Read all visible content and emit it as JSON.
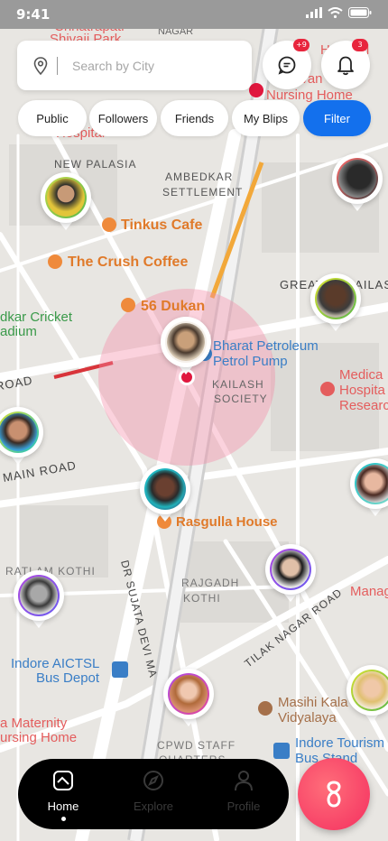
{
  "status_bar": {
    "time": "9:41"
  },
  "search": {
    "placeholder": "Search by City"
  },
  "header": {
    "messages_badge": "+9",
    "notifications_badge": "3"
  },
  "filters": {
    "chips": [
      "Public",
      "Followers",
      "Friends",
      "My Blips"
    ],
    "filter_label": "Filter"
  },
  "map_labels": {
    "chhatrapati": "Chhatrapati",
    "shivaji_park": "Shivaji Park",
    "nagar": "NAGAR",
    "hospital_top": "Hospital",
    "navjivan": "Navjivan",
    "nursing_home": "Nursing Home",
    "hospital_left": "Hospital",
    "new_palasia": "NEW PALASIA",
    "ambedkar": "AMBEDKAR",
    "settlement": "SETTLEMENT",
    "tinkus": "Tinkus Cafe",
    "crush": "The Crush Coffee",
    "greater": "GREATER KAILASH",
    "cricket": "dkar Cricket",
    "stadium": "adium",
    "dukan": "56 Dukan",
    "bharat": "Bharat Petroleum",
    "petrol": "Petrol Pump",
    "kailash": "KAILASH",
    "society": "SOCIETY",
    "medica": "Medica",
    "hospital_r": "Hospita",
    "research": "Researc",
    "road": "ROAD",
    "main_road": "MAIN ROAD",
    "rasgulla": "Rasgulla House",
    "kothi": "RATLAM KOTHI",
    "rajgadh": "RAJGADH",
    "kothi2": "KOTHI",
    "sujata": "DR SUJATA DEVI MA",
    "tilak": "TILAK NAGAR ROAD",
    "manag": "Manag",
    "aictsl": "Indore AICTSL",
    "bus_depot": "Bus Depot",
    "masihi": "Masihi Kala",
    "vidyalaya": "Vidyalaya",
    "maternity": "a Maternity",
    "nursing2": "ursing Home",
    "cpwd": "CPWD STAFF",
    "quarters": "QUARTERS",
    "tourism": "Indore Tourism",
    "bus_stand": "Bus Stand"
  },
  "nav": {
    "items": [
      "Home",
      "Explore",
      "Profile"
    ],
    "active": "Home"
  },
  "colors": {
    "accent": "#1370ed",
    "fab": "#f4405f",
    "badge": "#e8253d"
  },
  "icons": [
    "location-pin-icon",
    "chat-icon",
    "bell-icon",
    "home-icon",
    "explore-icon",
    "profile-icon",
    "app-logo-icon"
  ]
}
